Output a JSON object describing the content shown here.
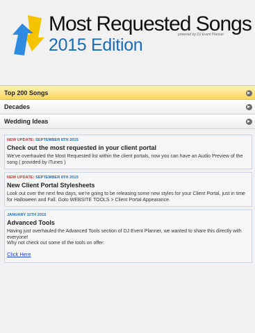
{
  "header": {
    "title": "Most Requested Songs",
    "powered": "powered by DJ Event Planner",
    "subtitle": "2015 Edition"
  },
  "menu": {
    "items": [
      {
        "label": "Top 200 Songs",
        "active": true
      },
      {
        "label": "Decades",
        "active": false
      },
      {
        "label": "Wedding Ideas",
        "active": false
      }
    ]
  },
  "news": [
    {
      "tag_new": "NEW UPDATE:",
      "date": "SEPTEMBER 8TH 2015",
      "title": "Check out the most requested in your client portal",
      "body": "We've overhauled the Most Requested list within the client portals, now you can have an Audio Preview of the song ( provided by iTunes )"
    },
    {
      "tag_new": "NEW UPDATE:",
      "date": "SEPTEMBER 8TH 2015",
      "title": "New Client Portal Stylesheets",
      "body": "Look out over the next few days, we're going to be releasing some new styles for your Client Portal, just in time for Halloween and Fall. Goto WEBSITE TOOLS > Client Portal Appearance."
    },
    {
      "tag_new": "",
      "date": "JANUARY 11TH 2015",
      "title": "Advanced Tools",
      "body": "Having just overhauled the Advanced Tools section of DJ Event Planner, we wanted to share this directly with everyone!",
      "body2": "Why not check out some of the tools on offer:",
      "link": "Click Here"
    }
  ],
  "colors": {
    "accent_blue": "#1a6bb5",
    "new_red": "#d12a2a",
    "active_yellow": "#f7d65a",
    "logo_yellow": "#f5c400"
  }
}
